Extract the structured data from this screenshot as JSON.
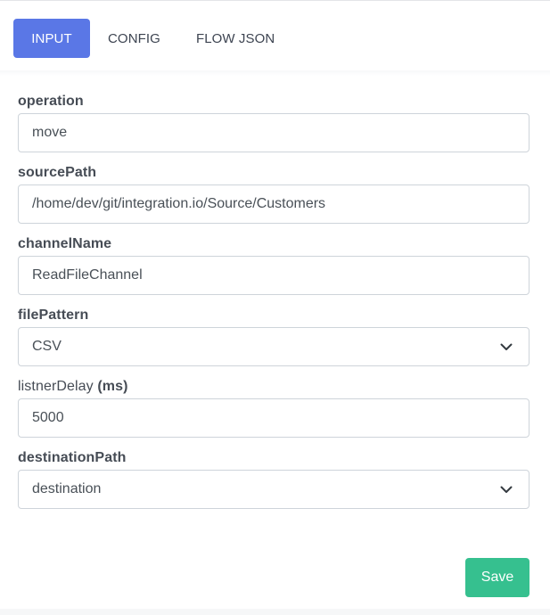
{
  "tabs": [
    {
      "label": "INPUT",
      "active": true
    },
    {
      "label": "CONFIG",
      "active": false
    },
    {
      "label": "FLOW JSON",
      "active": false
    }
  ],
  "fields": {
    "operation": {
      "label": "operation",
      "value": "move"
    },
    "sourcePath": {
      "label": "sourcePath",
      "value": "/home/dev/git/integration.io/Source/Customers"
    },
    "channelName": {
      "label": "channelName",
      "value": "ReadFileChannel"
    },
    "filePattern": {
      "label": "filePattern",
      "value": "CSV",
      "icon": "chevron-down-icon"
    },
    "listnerDelay": {
      "label": "listnerDelay",
      "unit": "(ms)",
      "value": "5000"
    },
    "destinationPath": {
      "label": "destinationPath",
      "value": "destination",
      "icon": "chevron-down-icon"
    }
  },
  "actions": {
    "save_label": "Save"
  },
  "colors": {
    "active_tab": "#5a77e6",
    "save_button": "#36c08f"
  }
}
